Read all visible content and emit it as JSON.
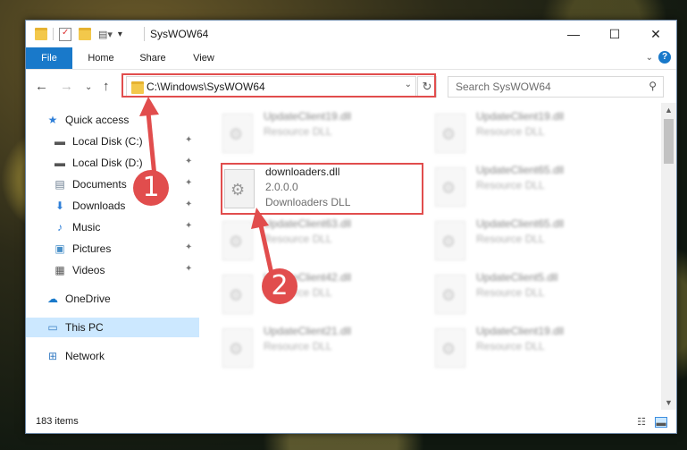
{
  "window": {
    "title": "SysWOW64",
    "minimize": "—",
    "maximize": "☐",
    "close": "✕"
  },
  "ribbon": {
    "tabs": [
      "File",
      "Home",
      "Share",
      "View"
    ],
    "help": "?",
    "collapse": "⌄"
  },
  "nav": {
    "back": "←",
    "forward": "→",
    "recent": "⌄",
    "up": "↑",
    "address": "C:\\Windows\\SysWOW64",
    "address_dropdown": "⌄",
    "refresh": "↻",
    "search_placeholder": "Search SysWOW64",
    "search_icon": "⚲"
  },
  "sidebar": {
    "items": [
      {
        "label": "Quick access",
        "icon": "star-icon",
        "glyph": "★",
        "pinned": false
      },
      {
        "label": "Local Disk (C:)",
        "icon": "drive-icon",
        "glyph": "▬",
        "pinned": true
      },
      {
        "label": "Local Disk (D:)",
        "icon": "drive-icon",
        "glyph": "▬",
        "pinned": true
      },
      {
        "label": "Documents",
        "icon": "document-icon",
        "glyph": "▤",
        "pinned": true
      },
      {
        "label": "Downloads",
        "icon": "download-icon",
        "glyph": "⬇",
        "pinned": true
      },
      {
        "label": "Music",
        "icon": "music-icon",
        "glyph": "♪",
        "pinned": true
      },
      {
        "label": "Pictures",
        "icon": "picture-icon",
        "glyph": "▣",
        "pinned": true
      },
      {
        "label": "Videos",
        "icon": "video-icon",
        "glyph": "▦",
        "pinned": true
      },
      {
        "label": "OneDrive",
        "icon": "cloud-icon",
        "glyph": "☁",
        "pinned": false
      },
      {
        "label": "This PC",
        "icon": "computer-icon",
        "glyph": "▭",
        "pinned": false
      },
      {
        "label": "Network",
        "icon": "network-icon",
        "glyph": "⊞",
        "pinned": false
      }
    ],
    "pin_glyph": "📌"
  },
  "files": {
    "left_column": [
      {
        "name": "UpdateClient19.dll",
        "type": "Resource DLL",
        "blurred": true
      },
      {
        "name": "downloaders.dll",
        "type": "2.0.0.0",
        "desc": "Downloaders DLL",
        "blurred": false
      },
      {
        "name": "UpdateClient63.dll",
        "type": "Resource DLL",
        "blurred": true
      },
      {
        "name": "UpdateClient42.dll",
        "type": "Resource DLL",
        "blurred": true
      },
      {
        "name": "UpdateClient21.dll",
        "type": "Resource DLL",
        "blurred": true
      }
    ],
    "right_column": [
      {
        "name": "UpdateClient19.dll",
        "type": "Resource DLL",
        "blurred": true
      },
      {
        "name": "UpdateClient65.dll",
        "type": "Resource DLL",
        "blurred": true
      },
      {
        "name": "UpdateClient65.dll",
        "type": "Resource DLL",
        "blurred": true
      },
      {
        "name": "UpdateClient5.dll",
        "type": "Resource DLL",
        "blurred": true
      },
      {
        "name": "UpdateClient19.dll",
        "type": "Resource DLL",
        "blurred": true
      }
    ]
  },
  "status": {
    "count": "183 items"
  },
  "annotations": {
    "badge1": "1",
    "badge2": "2",
    "color": "#e14d4d"
  }
}
